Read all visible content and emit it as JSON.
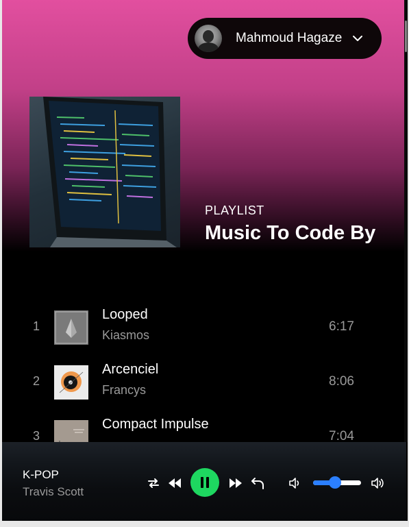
{
  "user": {
    "name": "Mahmoud Hagaze"
  },
  "playlist": {
    "label": "PLAYLIST",
    "title": "Music To Code By"
  },
  "tracks": [
    {
      "number": "1",
      "title": "Looped",
      "artist": "Kiasmos",
      "duration": "6:17"
    },
    {
      "number": "2",
      "title": "Arcenciel",
      "artist": "Francys",
      "duration": "8:06"
    },
    {
      "number": "3",
      "title": "Compact Impulse",
      "artist": "",
      "duration": "7:04"
    }
  ],
  "player": {
    "now_playing_title": "K-POP",
    "now_playing_artist": "Travis Scott",
    "volume": 0.45,
    "state": "playing"
  },
  "colors": {
    "accent_green": "#1ed760",
    "slider_blue": "#2b7fff",
    "header_pink": "#e24f9f"
  },
  "icons": [
    "chevron-down-icon",
    "shuffle-icon",
    "previous-icon",
    "pause-icon",
    "next-icon",
    "repeat-icon",
    "volume-low-icon",
    "volume-high-icon"
  ]
}
